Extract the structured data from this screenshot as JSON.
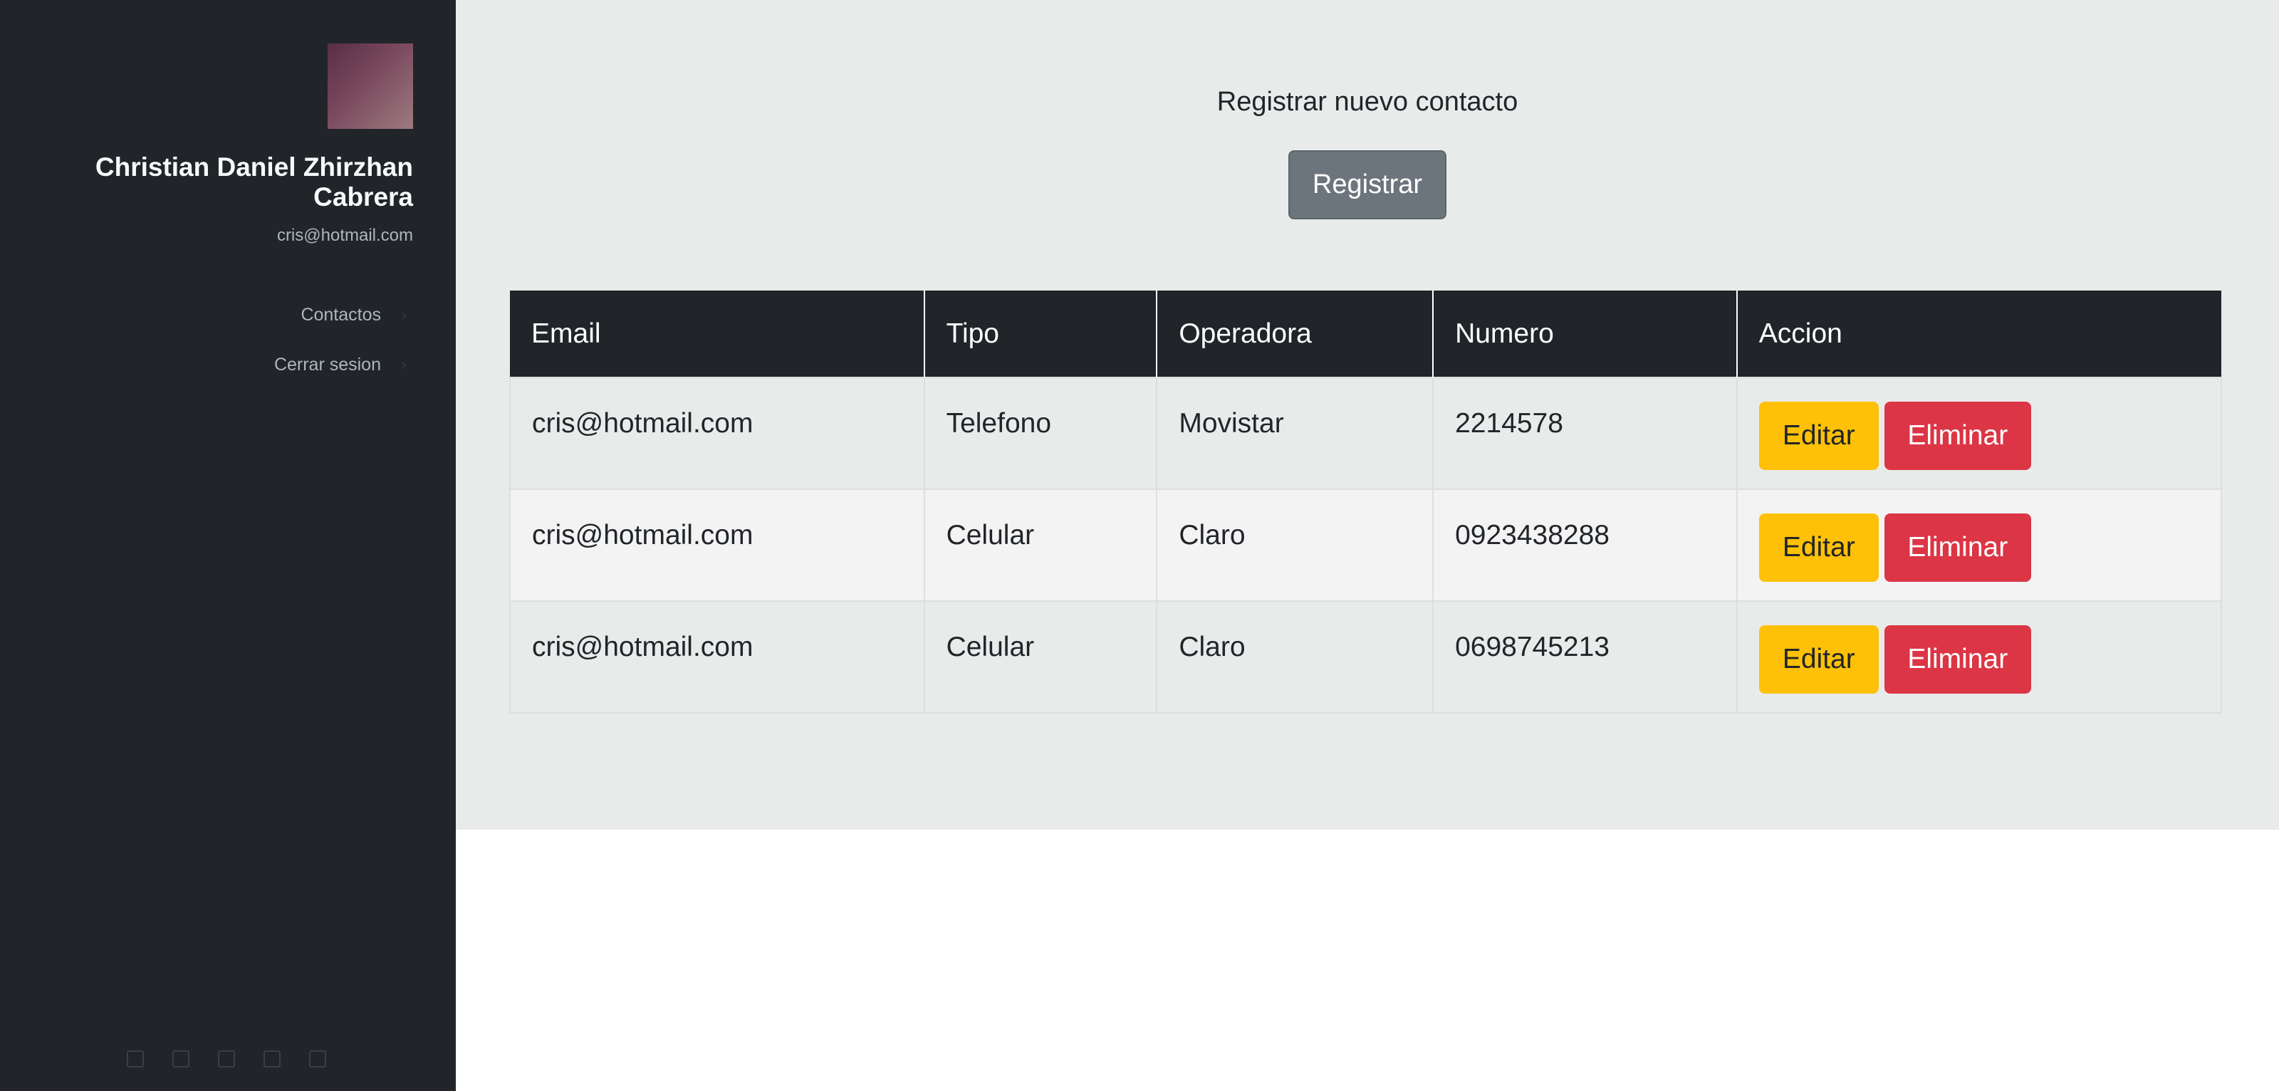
{
  "sidebar": {
    "profile": {
      "name": "Christian Daniel Zhirzhan Cabrera",
      "email": "cris@hotmail.com"
    },
    "nav": [
      {
        "label": "Contactos"
      },
      {
        "label": "Cerrar sesion"
      }
    ],
    "social_icons": [
      "social-icon-1",
      "social-icon-2",
      "social-icon-3",
      "social-icon-4",
      "social-icon-5"
    ]
  },
  "main": {
    "heading": "Registrar nuevo contacto",
    "register_label": "Registrar",
    "table": {
      "headers": [
        "Email",
        "Tipo",
        "Operadora",
        "Numero",
        "Accion"
      ],
      "rows": [
        {
          "email": "cris@hotmail.com",
          "tipo": "Telefono",
          "operadora": "Movistar",
          "numero": "2214578"
        },
        {
          "email": "cris@hotmail.com",
          "tipo": "Celular",
          "operadora": "Claro",
          "numero": "0923438288"
        },
        {
          "email": "cris@hotmail.com",
          "tipo": "Celular",
          "operadora": "Claro",
          "numero": "0698745213"
        }
      ],
      "edit_label": "Editar",
      "delete_label": "Eliminar"
    }
  },
  "colors": {
    "sidebar_bg": "#212529",
    "main_bg": "#e8ebea",
    "register_button": "#6c757d",
    "edit_button": "#ffc107",
    "delete_button": "#dc3545"
  }
}
